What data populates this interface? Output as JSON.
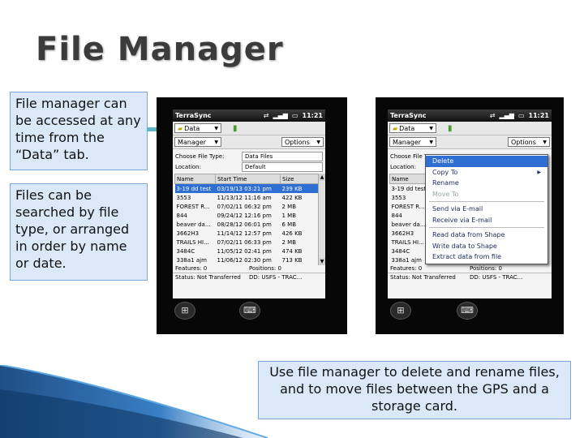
{
  "title": "File Manager",
  "callouts": {
    "data_tab": "File manager can be accessed at any time from the “Data” tab.",
    "search": "Files can be searched by file type, or arranged in order by name or date.",
    "use": "Use file manager to delete and rename files, and to move files between the GPS and a storage card."
  },
  "device": {
    "app_name": "TerraSync",
    "time": "11:21",
    "data_label": "Data",
    "manager_label": "Manager",
    "options_label": "Options",
    "choose_file_type_label": "Choose File Type:",
    "choose_file_type_value": "Data Files",
    "location_label": "Location:",
    "location_value": "Default",
    "columns": [
      "Name",
      "Start Time",
      "Size"
    ],
    "files": [
      {
        "name": "3-19 dd test",
        "start": "03/19/13 03:21 pm",
        "size": "239 KB",
        "selected": true
      },
      {
        "name": "3553",
        "start": "11/13/12 11:16 am",
        "size": "422 KB"
      },
      {
        "name": "FOREST R...",
        "start": "07/02/11 06:32 pm",
        "size": "2 MB"
      },
      {
        "name": "844",
        "start": "09/24/12 12:16 pm",
        "size": "1 MB"
      },
      {
        "name": "beaver da...",
        "start": "08/28/12 06:01 pm",
        "size": "6 MB"
      },
      {
        "name": "3662H3",
        "start": "11/14/12 12:57 pm",
        "size": "426 KB"
      },
      {
        "name": "TRAILS HI...",
        "start": "07/02/11 06:33 pm",
        "size": "2 MB"
      },
      {
        "name": "3484C",
        "start": "11/05/12 02:41 pm",
        "size": "474 KB"
      },
      {
        "name": "338a1 ajm",
        "start": "11/06/12 02:30 pm",
        "size": "713 KB"
      }
    ],
    "features_label": "Features:",
    "features_value": "0",
    "positions_label": "Positions:",
    "positions_value": "0",
    "status_text": "Status: Not Transferred",
    "dd_text": "DD: USFS - TRAC...",
    "context_menu": {
      "delete": "Delete",
      "copy_to": "Copy To",
      "rename": "Rename",
      "move_to": "Move To",
      "send_email": "Send via E-mail",
      "receive_email": "Receive via E-mail",
      "read_shape": "Read data from Shape",
      "write_shape": "Write data to Shape",
      "extract_file": "Extract data from file"
    }
  },
  "colors": {
    "callout_bg": "#dbe8f8",
    "callout_border": "#7aa7d6",
    "selection": "#2f6fd4",
    "arrow": "#5fb3c8"
  }
}
